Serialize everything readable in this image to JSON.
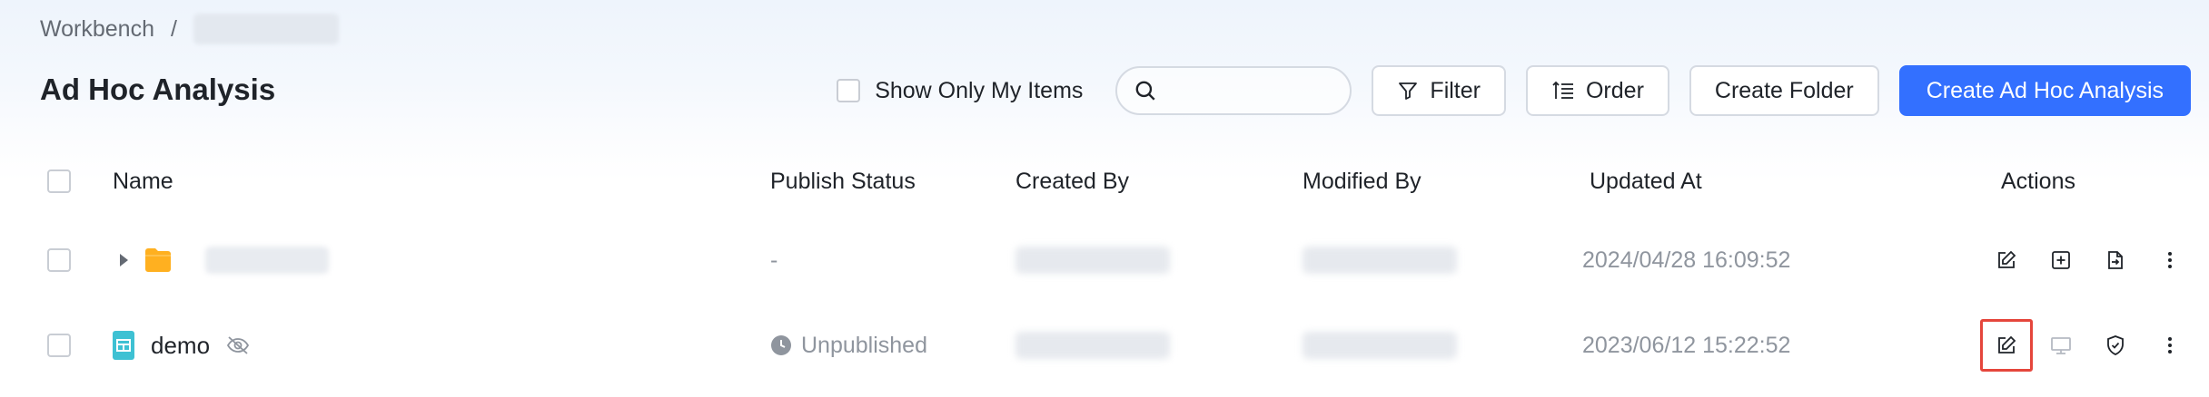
{
  "breadcrumb": {
    "root": "Workbench",
    "separator": "/"
  },
  "page": {
    "title": "Ad Hoc Analysis"
  },
  "toolbar": {
    "show_mine_label": "Show Only My Items",
    "search_placeholder": "",
    "filter_label": "Filter",
    "order_label": "Order",
    "create_folder_label": "Create Folder",
    "create_analysis_label": "Create Ad Hoc Analysis"
  },
  "table": {
    "columns": {
      "name": "Name",
      "publish_status": "Publish Status",
      "created_by": "Created By",
      "modified_by": "Modified By",
      "updated_at": "Updated At",
      "actions": "Actions"
    },
    "rows": [
      {
        "type": "folder",
        "name": "",
        "publish_status": "-",
        "updated_at": "2024/04/28 16:09:52",
        "actions": [
          "edit-icon",
          "add-icon",
          "move-icon",
          "more-icon"
        ]
      },
      {
        "type": "analysis",
        "name": "demo",
        "publish_status": "Unpublished",
        "updated_at": "2023/06/12 15:22:52",
        "actions": [
          "edit-icon",
          "monitor-icon",
          "shield-icon",
          "more-icon"
        ]
      }
    ]
  },
  "colors": {
    "accent": "#3370ff",
    "folder": "#ffb020",
    "dataset": "#3ec1d3",
    "highlight": "#e5463c"
  }
}
